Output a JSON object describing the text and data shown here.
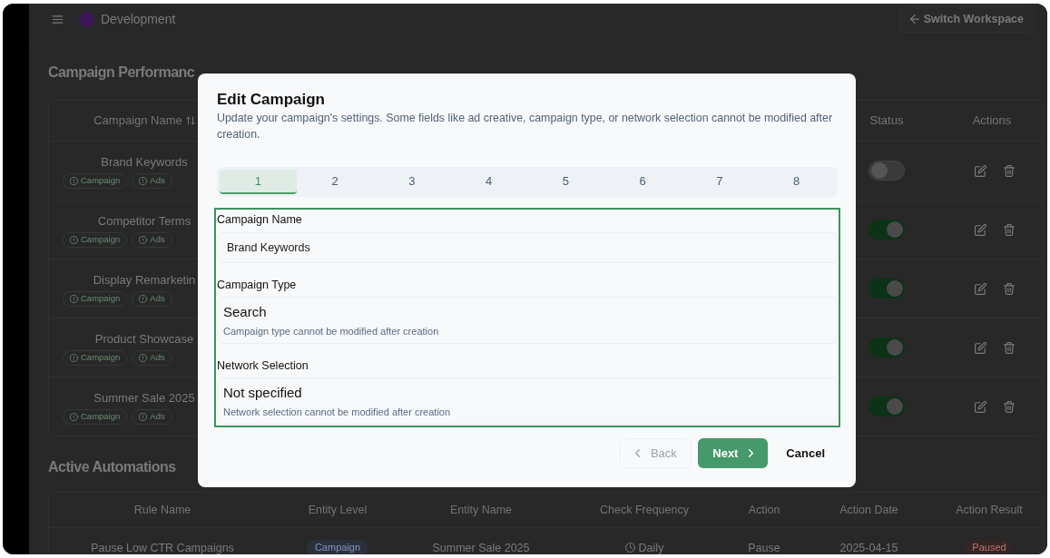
{
  "header": {
    "workspace": "Development",
    "switch_button": "Switch Workspace"
  },
  "campaign_performance": {
    "title": "Campaign Performanc",
    "columns": [
      {
        "label": "Campaign Name",
        "sortable": true
      },
      {
        "label": "Status",
        "sortable": false
      },
      {
        "label": "Actions",
        "sortable": false
      }
    ],
    "rows": [
      {
        "name": "Brand Keywords",
        "tags": [
          "Campaign",
          "Ads"
        ],
        "on": false
      },
      {
        "name": "Competitor Terms",
        "tags": [
          "Campaign",
          "Ads"
        ],
        "on": true
      },
      {
        "name": "Display Remarketin",
        "tags": [
          "Campaign",
          "Ads"
        ],
        "on": true
      },
      {
        "name": "Product Showcase",
        "tags": [
          "Campaign",
          "Ads"
        ],
        "on": true
      },
      {
        "name": "Summer Sale 2025",
        "tags": [
          "Campaign",
          "Ads"
        ],
        "on": true
      }
    ]
  },
  "active_automations": {
    "title": "Active Automations",
    "columns": [
      "Rule Name",
      "Entity Level",
      "Entity Name",
      "Check Frequency",
      "Action",
      "Action Date",
      "Action Result"
    ],
    "rows": [
      {
        "cells": [
          {
            "kind": "text",
            "text": "Pause Low CTR Campaigns"
          },
          {
            "kind": "level",
            "text": "Campaign"
          },
          {
            "kind": "text",
            "text": "Summer Sale 2025"
          },
          {
            "kind": "frequency",
            "text": "Daily"
          },
          {
            "kind": "text",
            "text": "Pause"
          },
          {
            "kind": "text",
            "text": "2025-04-15"
          },
          {
            "kind": "result",
            "text": "Paused"
          }
        ]
      }
    ]
  },
  "dialog": {
    "title": "Edit Campaign",
    "description": "Update your campaign's settings. Some fields like ad creative, campaign type, or network selection cannot be modified after creation.",
    "steps": [
      {
        "label": "1",
        "selected": true
      },
      {
        "label": "2",
        "selected": false
      },
      {
        "label": "3",
        "selected": false
      },
      {
        "label": "4",
        "selected": false
      },
      {
        "label": "5",
        "selected": false
      },
      {
        "label": "6",
        "selected": false
      },
      {
        "label": "7",
        "selected": false
      },
      {
        "label": "8",
        "selected": false
      }
    ],
    "fields": [
      {
        "kind": "input",
        "label": "Campaign Name",
        "value": "Brand Keywords"
      },
      {
        "kind": "readonly",
        "label": "Campaign Type",
        "value": "Search",
        "hint": "Campaign type cannot be modified after creation"
      },
      {
        "kind": "readonly",
        "label": "Network Selection",
        "value": "Not specified",
        "hint": "Network selection cannot be modified after creation"
      }
    ],
    "buttons": [
      {
        "kind": "back",
        "label": "Back",
        "disabled": true
      },
      {
        "kind": "next",
        "label": "Next",
        "disabled": false
      },
      {
        "kind": "cancel",
        "label": "Cancel",
        "disabled": false
      }
    ]
  }
}
